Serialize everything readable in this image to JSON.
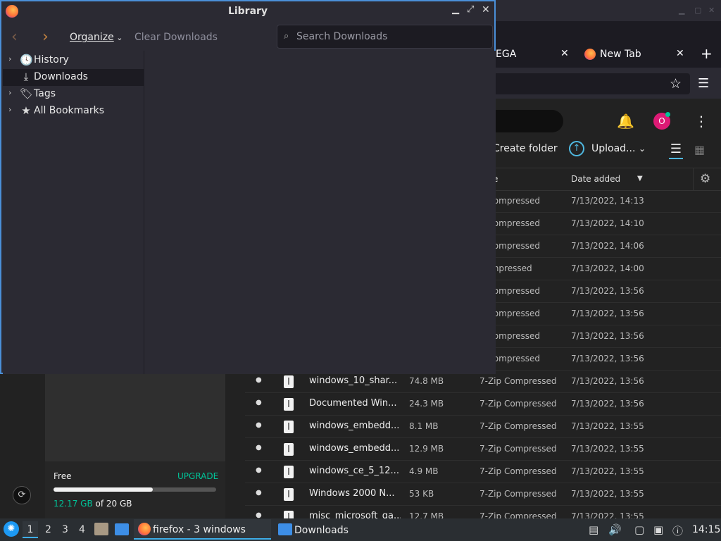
{
  "browser": {
    "tabs": [
      {
        "label": "EGA"
      },
      {
        "label": "New Tab"
      }
    ],
    "new_tab_symbol": "+",
    "close_symbol": "✕",
    "window_controls": [
      "▁",
      "▢",
      "✕"
    ]
  },
  "mega": {
    "avatar_letter": "O",
    "create_folder_label": "Create folder",
    "upload_label": "Upload...",
    "table_headers": {
      "type": "e",
      "date": "Date added"
    },
    "files": [
      {
        "name": "",
        "size": "",
        "type": "p Compressed",
        "date": "7/13/2022, 14:13"
      },
      {
        "name": "",
        "size": "",
        "type": "p Compressed",
        "date": "7/13/2022, 14:10"
      },
      {
        "name": "",
        "size": "",
        "type": "p Compressed",
        "date": "7/13/2022, 14:06"
      },
      {
        "name": "",
        "size": "",
        "type": " Compressed",
        "date": "7/13/2022, 14:00"
      },
      {
        "name": "",
        "size": "",
        "type": "p Compressed",
        "date": "7/13/2022, 13:56"
      },
      {
        "name": "",
        "size": "",
        "type": "p Compressed",
        "date": "7/13/2022, 13:56"
      },
      {
        "name": "",
        "size": "",
        "type": "p Compressed",
        "date": "7/13/2022, 13:56"
      },
      {
        "name": "",
        "size": "",
        "type": "p Compressed",
        "date": "7/13/2022, 13:56"
      },
      {
        "name": "windows_10_shar...",
        "size": "74.8 MB",
        "type": "7-Zip Compressed",
        "date": "7/13/2022, 13:56"
      },
      {
        "name": "Documented Win...",
        "size": "24.3 MB",
        "type": "7-Zip Compressed",
        "date": "7/13/2022, 13:56"
      },
      {
        "name": "windows_embedd...",
        "size": "8.1 MB",
        "type": "7-Zip Compressed",
        "date": "7/13/2022, 13:55"
      },
      {
        "name": "windows_embedd...",
        "size": "12.9 MB",
        "type": "7-Zip Compressed",
        "date": "7/13/2022, 13:55"
      },
      {
        "name": "windows_ce_5_12...",
        "size": "4.9 MB",
        "type": "7-Zip Compressed",
        "date": "7/13/2022, 13:55"
      },
      {
        "name": "Windows 2000 N...",
        "size": "53 KB",
        "type": "7-Zip Compressed",
        "date": "7/13/2022, 13:55"
      },
      {
        "name": "misc_microsoft_ga...",
        "size": "12.7 MB",
        "type": "7-Zip Compressed",
        "date": "7/13/2022, 13:55"
      }
    ],
    "storage": {
      "free_label": "Free",
      "upgrade_label": "UPGRADE",
      "used": "12.17 GB",
      "of_text": "of 20 GB",
      "used_fraction": 0.6085
    }
  },
  "library": {
    "title": "Library",
    "organize_label": "Organize",
    "clear_downloads_label": "Clear Downloads",
    "search_placeholder": "Search Downloads",
    "tree": [
      {
        "label": "History",
        "icon": "clock-icon",
        "has_twisty": true,
        "selected": false
      },
      {
        "label": "Downloads",
        "icon": "download-icon",
        "has_twisty": false,
        "selected": true
      },
      {
        "label": "Tags",
        "icon": "tag-icon",
        "has_twisty": true,
        "selected": false
      },
      {
        "label": "All Bookmarks",
        "icon": "star-icon",
        "has_twisty": true,
        "selected": false
      }
    ]
  },
  "taskbar": {
    "workspaces": [
      "1",
      "2",
      "3",
      "4"
    ],
    "firefox_task_label": "firefox - 3 windows",
    "downloads_task_label": "Downloads",
    "clock": "14:15"
  },
  "colors": {
    "accent": "#3daee9",
    "mega_green": "#00c398",
    "library_border": "#4a8fd8"
  }
}
